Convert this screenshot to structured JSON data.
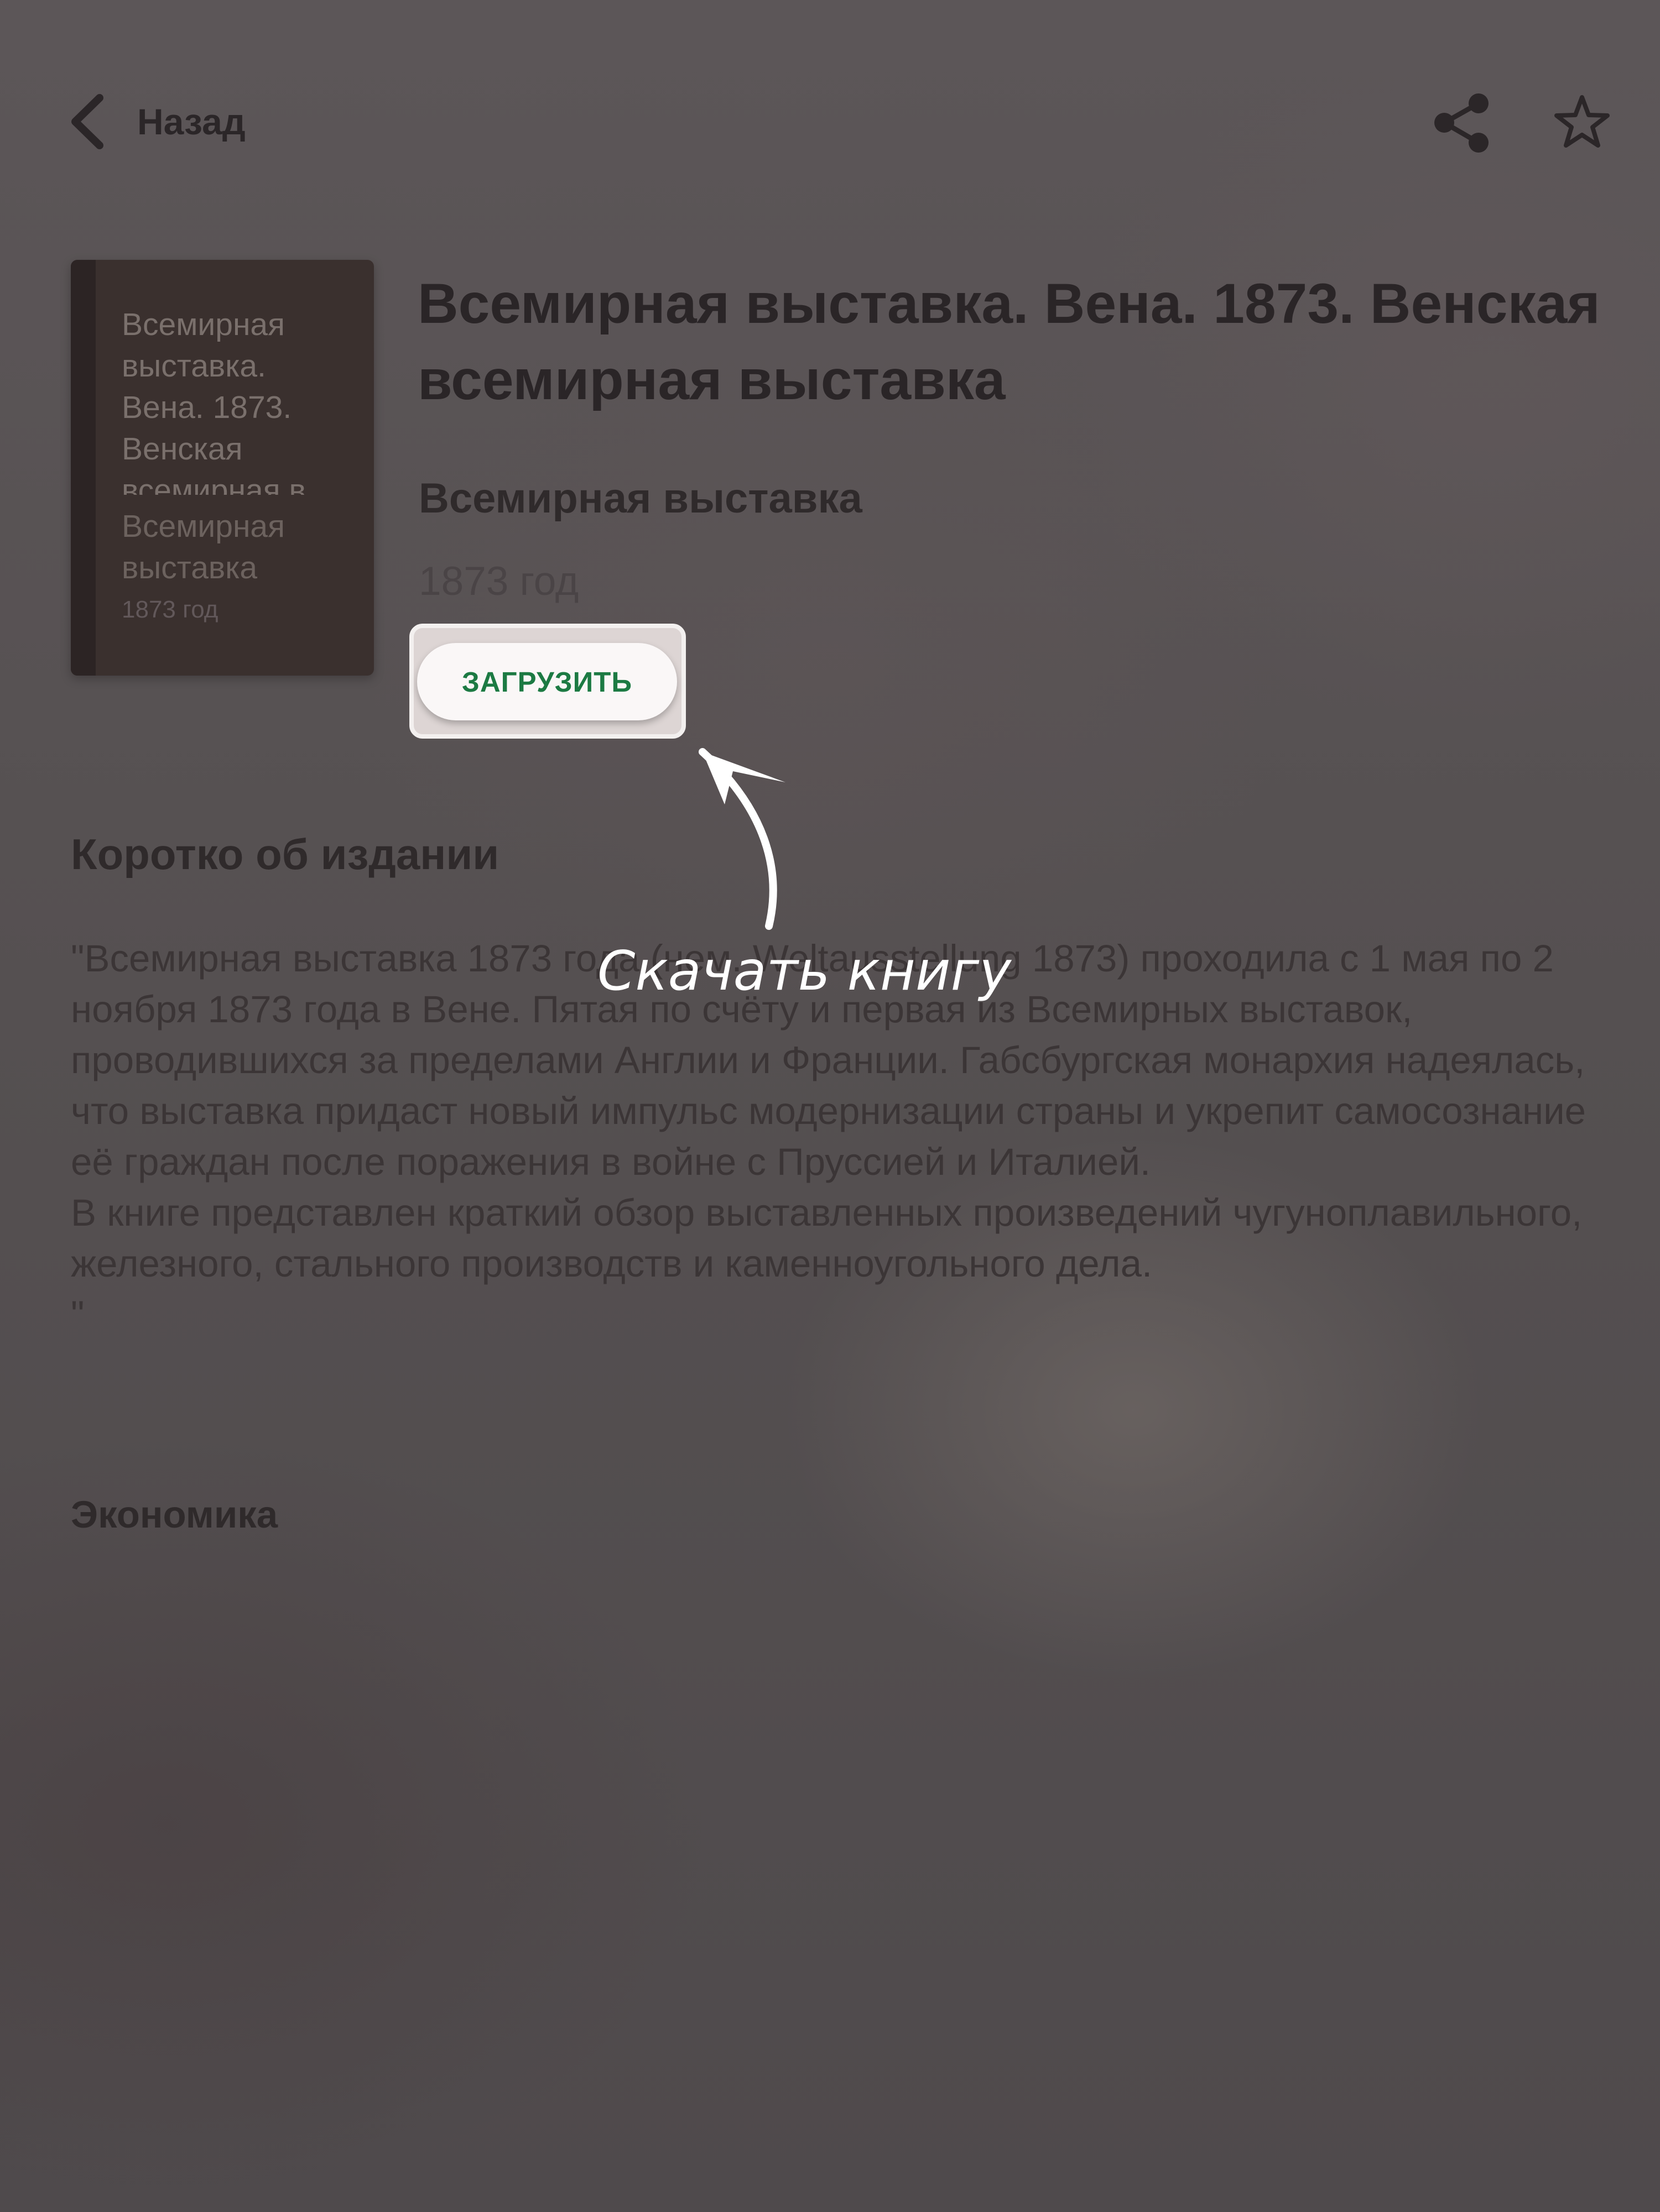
{
  "header": {
    "back_label": "Назад",
    "icons": [
      "chevron-left-icon",
      "share-icon",
      "star-icon"
    ]
  },
  "cover": {
    "title": "Всемирная выставка. Вена. 1873. Венская всемирная в...",
    "series": "Всемирная выставка",
    "year": "1873 год"
  },
  "book": {
    "title": "Всемирная выставка. Вена. 1873. Венская всемирная выставка",
    "series": "Всемирная выставка",
    "year": "1873 год",
    "download_label": "ЗАГРУЗИТЬ"
  },
  "annotation": {
    "text": "Скачать книгу"
  },
  "about": {
    "heading": "Коротко об издании",
    "text": "\"Всемирная выставка 1873 года (нем. Weltausstellung 1873) проходила с 1 мая по 2 ноября 1873 года в Вене. Пятая по счёту и первая из Всемирных выставок, проводившихся за пределами Англии и Франции. Габсбургская монархия надеялась, что выставка придаст новый импульс модернизации страны и укрепит самосознание её граждан после поражения в войне с Пруссией и Италией.\nВ книге представлен краткий обзор выставленных произведений чугуноплавильного, железного, стального производств и каменноугольного дела.\n\"",
    "category": "Экономика"
  },
  "colors": {
    "overlay": "#565052",
    "download_text": "#1c7a43",
    "callout_text": "#ffffff"
  }
}
